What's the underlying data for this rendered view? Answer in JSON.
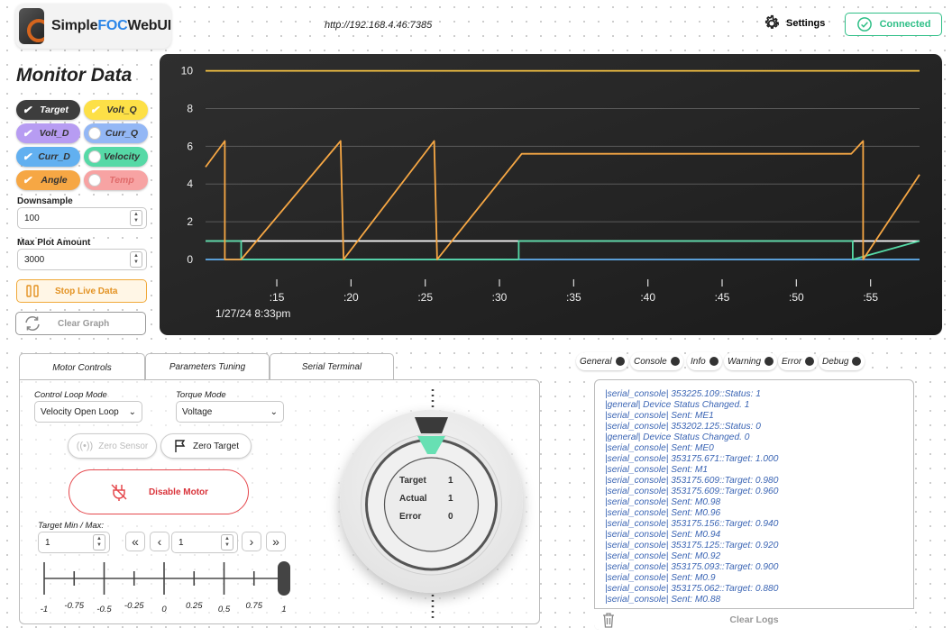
{
  "header": {
    "brand_prefix": "Simple",
    "brand_mid": "FOC",
    "brand_suffix": "WebUI",
    "url": "http://192.168.4.46:7385",
    "settings_label": "Settings",
    "connected_label": "Connected"
  },
  "monitor": {
    "title": "Monitor Data",
    "chips": [
      {
        "label": "Target",
        "checked": true,
        "color": "#3d3d3d",
        "text_color": "#ffffff"
      },
      {
        "label": "Volt_Q",
        "checked": true,
        "color": "#fde047",
        "text_color": "#333333"
      },
      {
        "label": "Volt_D",
        "checked": true,
        "color": "#b79cf2",
        "text_color": "#333333"
      },
      {
        "label": "Curr_Q",
        "checked": false,
        "color": "#93b7f5",
        "text_color": "#333333"
      },
      {
        "label": "Curr_D",
        "checked": true,
        "color": "#62b0f0",
        "text_color": "#333333"
      },
      {
        "label": "Velocity",
        "checked": false,
        "color": "#56d9a6",
        "text_color": "#333333"
      },
      {
        "label": "Angle",
        "checked": true,
        "color": "#f6a744",
        "text_color": "#333333"
      },
      {
        "label": "Temp",
        "checked": false,
        "color": "#f7a3a3",
        "text_color": "#e06b6b"
      }
    ],
    "downsample_label": "Downsample",
    "downsample_value": "100",
    "max_plot_label": "Max Plot Amount",
    "max_plot_value": "3000",
    "live_button": "Stop Live Data",
    "clear_button": "Clear Graph"
  },
  "chart_data": {
    "type": "line",
    "title": "",
    "xlabel": "",
    "ylabel": "",
    "date_label": "1/27/24 8:33pm",
    "x_ticks": [
      ":15",
      ":20",
      ":25",
      ":30",
      ":35",
      ":40",
      ":45",
      ":50",
      ":55"
    ],
    "x_tick_seconds": [
      15,
      20,
      25,
      30,
      35,
      40,
      45,
      50,
      55
    ],
    "xlim": [
      10.2,
      58.3
    ],
    "y_ticks": [
      "0",
      "2",
      "4",
      "6",
      "8",
      "10"
    ],
    "ylim": [
      0,
      10.6
    ],
    "grid": true,
    "series": [
      {
        "color": "#f6c343",
        "x": [
          10.2,
          58.3
        ],
        "y": [
          10,
          10
        ]
      },
      {
        "color": "#62b0f0",
        "x": [
          10.2,
          58.3
        ],
        "y": [
          0,
          0
        ]
      },
      {
        "color": "#ffffff",
        "x": [
          10.2,
          58.3
        ],
        "y": [
          0.98,
          0.98
        ]
      },
      {
        "color": "#56d9a6",
        "x": [
          10.2,
          12.6,
          12.6,
          31.3,
          31.3,
          53.8,
          53.8,
          58.3
        ],
        "y": [
          0.98,
          0.98,
          0,
          0,
          0.98,
          0.98,
          0,
          0.98
        ]
      },
      {
        "color": "#f6a744",
        "x": [
          10.2,
          11.5,
          11.5,
          12.6,
          19.3,
          19.5,
          25.6,
          25.8,
          31.5,
          53.7,
          54.5,
          54.5,
          58.3
        ],
        "y": [
          4.9,
          6.28,
          0,
          0,
          6.28,
          0,
          6.28,
          0,
          5.6,
          5.6,
          6.28,
          0,
          4.5
        ]
      }
    ]
  },
  "motor": {
    "tabs": [
      "Motor Controls",
      "Parameters Tuning",
      "Serial Terminal"
    ],
    "control_loop_label": "Control Loop Mode",
    "control_loop_value": "Velocity Open Loop",
    "torque_mode_label": "Torque Mode",
    "torque_mode_value": "Voltage",
    "zero_sensor": "Zero Sensor",
    "zero_target": "Zero Target",
    "disable_motor": "Disable Motor",
    "target_minmax_label": "Target Min / Max:",
    "target_minmax_value": "1",
    "target_value": "1",
    "slider_ticks": [
      "-1",
      "-0.75",
      "-0.5",
      "-0.25",
      "0",
      "0.25",
      "0.5",
      "0.75",
      "1"
    ],
    "slider_value": 1
  },
  "dial": {
    "target_label": "Target",
    "target_value": "1",
    "actual_label": "Actual",
    "actual_value": "1",
    "error_label": "Error",
    "error_value": "0"
  },
  "logs": {
    "filters": [
      "General",
      "Console",
      "Info",
      "Warning",
      "Error",
      "Debug"
    ],
    "lines": [
      "|serial_console| 353225.109::Status: 1",
      "|general| Device Status Changed. 1",
      "|serial_console| Sent: ME1",
      "|serial_console| 353202.125::Status: 0",
      "|general| Device Status Changed. 0",
      "|serial_console| Sent: ME0",
      "|serial_console| 353175.671::Target: 1.000",
      "|serial_console| Sent: M1",
      "|serial_console| 353175.609::Target: 0.980",
      "|serial_console| 353175.609::Target: 0.960",
      "|serial_console| Sent: M0.98",
      "|serial_console| Sent: M0.96",
      "|serial_console| 353175.156::Target: 0.940",
      "|serial_console| Sent: M0.94",
      "|serial_console| 353175.125::Target: 0.920",
      "|serial_console| Sent: M0.92",
      "|serial_console| 353175.093::Target: 0.900",
      "|serial_console| Sent: M0.9",
      "|serial_console| 353175.062::Target: 0.880",
      "|serial_console| Sent: M0.88"
    ],
    "clear_label": "Clear Logs"
  }
}
